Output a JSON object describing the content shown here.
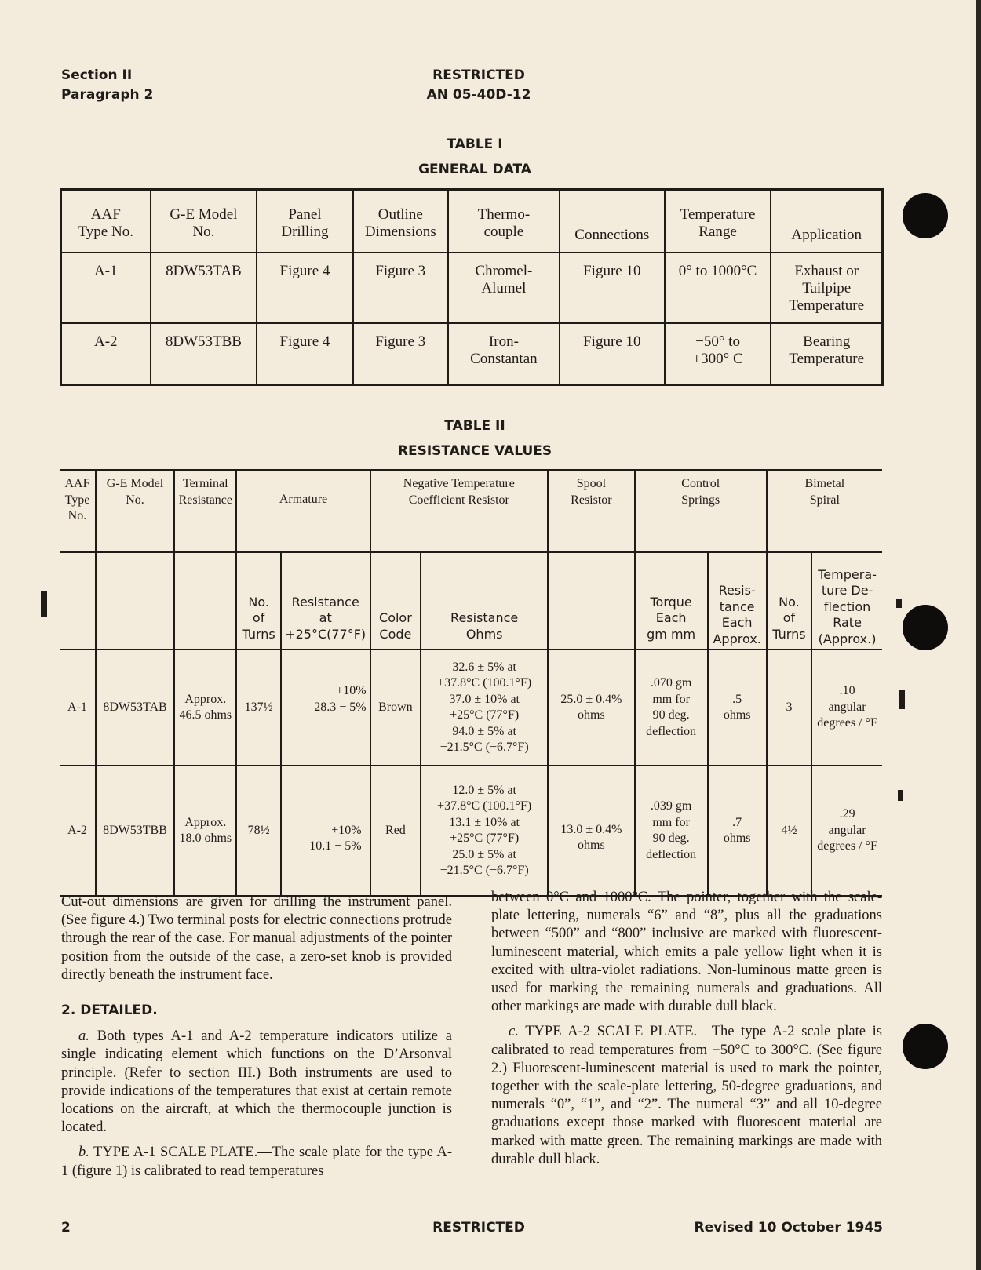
{
  "header": {
    "section": "Section II",
    "paragraph": "Paragraph 2",
    "classification": "RESTRICTED",
    "doc_number": "AN 05-40D-12"
  },
  "table1": {
    "number": "TABLE I",
    "title": "GENERAL DATA",
    "columns": [
      [
        "AAF",
        "Type No."
      ],
      [
        "G-E Model",
        "No."
      ],
      [
        "Panel",
        "Drilling"
      ],
      [
        "Outline",
        "Dimensions"
      ],
      [
        "Thermo-",
        "couple"
      ],
      [
        "Connections"
      ],
      [
        "Temperature",
        "Range"
      ],
      [
        "Application"
      ]
    ],
    "rows": [
      {
        "type": "A-1",
        "model": "8DW53TAB",
        "panel": "Figure 4",
        "outline": "Figure 3",
        "thermo": [
          "Chromel-",
          "Alumel"
        ],
        "connections": "Figure 10",
        "range": [
          "0° to 1000°C"
        ],
        "application": [
          "Exhaust or",
          "Tailpipe",
          "Temperature"
        ]
      },
      {
        "type": "A-2",
        "model": "8DW53TBB",
        "panel": "Figure 4",
        "outline": "Figure 3",
        "thermo": [
          "Iron-",
          "Constantan"
        ],
        "connections": "Figure 10",
        "range": [
          "−50° to",
          "+300° C"
        ],
        "application": [
          "Bearing",
          "Temperature"
        ]
      }
    ]
  },
  "table2": {
    "number": "TABLE II",
    "title": "RESISTANCE VALUES",
    "group_headers": {
      "type": [
        "AAF",
        "Type",
        "No."
      ],
      "model": [
        "G-E Model",
        "No."
      ],
      "terminal": [
        "Terminal",
        "Resistance"
      ],
      "armature": [
        "Armature"
      ],
      "ntc": [
        "Negative Temperature",
        "Coefficient Resistor"
      ],
      "spool": [
        "Spool",
        "Resistor"
      ],
      "springs": [
        "Control",
        "Springs"
      ],
      "bimetal": [
        "Bimetal",
        "Spiral"
      ]
    },
    "sub_headers": {
      "arm_turns": [
        "No.",
        "of",
        "Turns"
      ],
      "arm_resistance": [
        "Resistance",
        "at",
        "+25°C(77°F)"
      ],
      "color_code": [
        "Color",
        "Code"
      ],
      "resistance_ohms": [
        "Resistance",
        "Ohms"
      ],
      "torque": [
        "Torque",
        "Each",
        "gm mm"
      ],
      "spring_resistance": [
        "Resis-",
        "tance",
        "Each",
        "Approx."
      ],
      "bimetal_turns": [
        "No.",
        "of",
        "Turns"
      ],
      "deflection_rate": [
        "Tempera-",
        "ture De-",
        "flection",
        "Rate",
        "(Approx.)"
      ]
    },
    "rows": [
      {
        "type": "A-1",
        "model": "8DW53TAB",
        "terminal": [
          "Approx.",
          "46.5 ohms"
        ],
        "arm_turns": "137½",
        "arm_resistance": {
          "nominal": "28.3",
          "plus": "+10%",
          "minus": "− 5%"
        },
        "color": "Brown",
        "ntc_ohms": [
          "32.6 ± 5% at",
          "+37.8°C (100.1°F)",
          "37.0 ± 10% at",
          "+25°C (77°F)",
          "94.0 ± 5% at",
          "−21.5°C (−6.7°F)"
        ],
        "spool": [
          "25.0 ± 0.4%",
          "ohms"
        ],
        "torque": [
          ".070 gm",
          "mm for",
          "90 deg.",
          "deflection"
        ],
        "spring_resistance": [
          ".5",
          "ohms"
        ],
        "bimetal_turns": "3",
        "deflection_rate": [
          ".10",
          "angular",
          "degrees / °F"
        ]
      },
      {
        "type": "A-2",
        "model": "8DW53TBB",
        "terminal": [
          "Approx.",
          "18.0 ohms"
        ],
        "arm_turns": "78½",
        "arm_resistance": {
          "nominal": "10.1",
          "plus": "+10%",
          "minus": "− 5%"
        },
        "color": "Red",
        "ntc_ohms": [
          "12.0 ± 5% at",
          "+37.8°C (100.1°F)",
          "13.1 ± 10% at",
          "+25°C (77°F)",
          "25.0 ± 5% at",
          "−21.5°C (−6.7°F)"
        ],
        "spool": [
          "13.0 ± 0.4%",
          "ohms"
        ],
        "torque": [
          ".039 gm",
          "mm for",
          "90 deg.",
          "deflection"
        ],
        "spring_resistance": [
          ".7",
          "ohms"
        ],
        "bimetal_turns": "4½",
        "deflection_rate": [
          ".29",
          "angular",
          "degrees / °F"
        ]
      }
    ]
  },
  "body": {
    "intro_paragraph": "Cut-out dimensions are given for drilling the instrument panel. (See figure 4.) Two terminal posts for electric connections protrude through the rear of the case. For manual adjustments of the pointer position from the outside of the case, a zero-set knob is provided directly beneath the instrument face.",
    "section_heading": "2. DETAILED.",
    "para_a_label": "a.",
    "para_a": "Both types A-1 and A-2 temperature indicators utilize a single indicating element which functions on the D’Arsonval principle. (Refer to section III.) Both instruments are used to provide indications of the temperatures that exist at certain remote locations on the aircraft, at which the thermocouple junction is located.",
    "para_b_label": "b.",
    "para_b_title": "TYPE A-1 SCALE PLATE.—",
    "para_b_start": "The scale plate for the type A-1 (figure 1) is calibrated to read temperatures",
    "para_b_cont": "between 0°C and 1000°C. The pointer, together with the scale-plate lettering, numerals “6” and “8”, plus all the graduations between “500” and “800” inclusive are marked with fluorescent-luminescent material, which emits a pale yellow light when it is excited with ultra-violet radiations. Non-luminous matte green is used for marking the remaining numerals and graduations. All other markings are made with durable dull black.",
    "para_c_label": "c.",
    "para_c_title": "TYPE A-2 SCALE PLATE.—",
    "para_c": "The type A-2 scale plate is calibrated to read temperatures from −50°C to 300°C. (See figure 2.) Fluorescent-luminescent material is used to mark the pointer, together with the scale-plate lettering, 50-degree graduations, and numerals “0”, “1”, and “2”. The numeral “3” and all 10-degree graduations except those marked with fluorescent material are marked with matte green. The remaining markings are made with durable dull black."
  },
  "footer": {
    "page_number": "2",
    "classification": "RESTRICTED",
    "revision": "Revised 10 October 1945"
  }
}
